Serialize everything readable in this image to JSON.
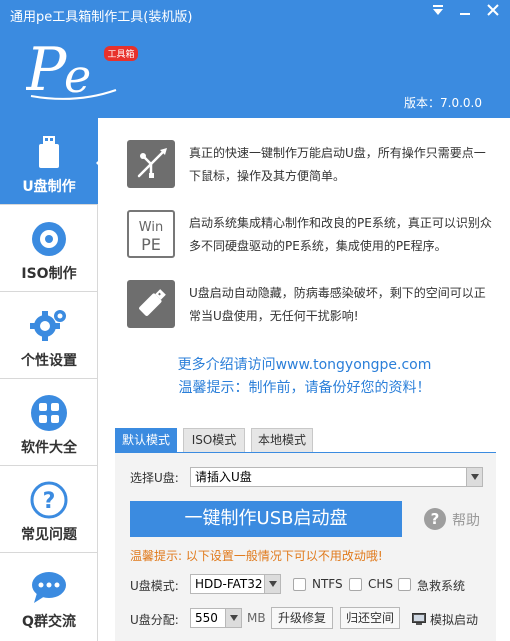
{
  "window": {
    "title": "通用pe工具箱制作工具(装机版)",
    "version": "版本：7.0.0.0",
    "logo_badge": "工具箱",
    "accent_color": "#3b8be0"
  },
  "sidebar": {
    "items": [
      {
        "label": "U盘制作",
        "icon": "usb-drive-icon"
      },
      {
        "label": "ISO制作",
        "icon": "disc-icon"
      },
      {
        "label": "个性设置",
        "icon": "gear-icon"
      },
      {
        "label": "软件大全",
        "icon": "apps-grid-icon"
      },
      {
        "label": "常见问题",
        "icon": "question-icon"
      },
      {
        "label": "Q群交流",
        "icon": "chat-bubble-icon"
      }
    ]
  },
  "features": [
    {
      "icon": "usb-symbol-icon",
      "text": "真正的快速一键制作万能启动U盘，所有操作只需要点一下鼠标，操作及其方便简单。"
    },
    {
      "icon": "winpe-icon",
      "icon_text_1": "Win",
      "icon_text_2": "PE",
      "text": "启动系统集成精心制作和改良的PE系统，真正可以识别众多不同硬盘驱动的PE系统，集成使用的PE程序。"
    },
    {
      "icon": "usb-stick-icon",
      "text": "U盘启动自动隐藏，防病毒感染破坏，剩下的空间可以正常当U盘使用，无任何干扰影响!"
    }
  ],
  "links": {
    "more_info": "更多介绍请访问www.tongyongpe.com",
    "backup_tip": "温馨提示：制作前，请备份好您的资料！"
  },
  "tabs": [
    "默认模式",
    "ISO模式",
    "本地模式"
  ],
  "panel": {
    "select_disk_label": "选择U盘:",
    "select_disk_value": "请插入U盘",
    "make_button": "一键制作USB启动盘",
    "help_label": "帮助",
    "warning": "温馨提示: 以下设置一般情况下可以不用改动哦!",
    "mode_label": "U盘模式:",
    "mode_value": "HDD-FAT32",
    "opt_ntfs": "NTFS",
    "opt_chs": "CHS",
    "opt_emergency": "急救系统",
    "alloc_label": "U盘分配:",
    "alloc_value": "550",
    "alloc_unit": "MB",
    "upgrade_button": "升级修复",
    "restore_button": "归还空间",
    "simulate_label": "模拟启动"
  }
}
